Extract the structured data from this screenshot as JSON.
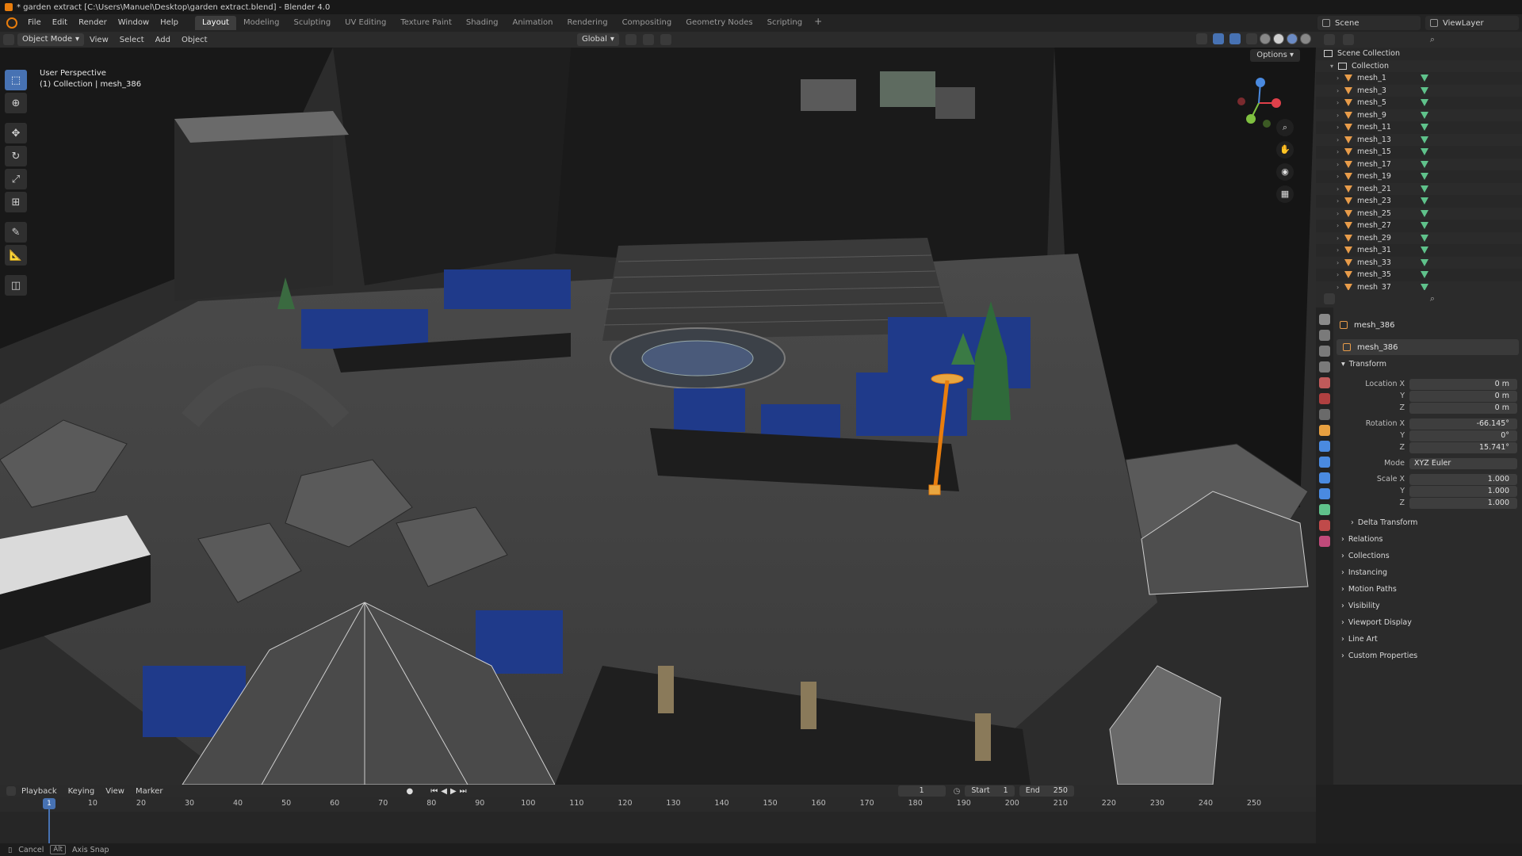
{
  "window": {
    "title": "* garden extract [C:\\Users\\Manuel\\Desktop\\garden extract.blend] - Blender 4.0"
  },
  "menu": [
    "File",
    "Edit",
    "Render",
    "Window",
    "Help"
  ],
  "workspaces": [
    "Layout",
    "Modeling",
    "Sculpting",
    "UV Editing",
    "Texture Paint",
    "Shading",
    "Animation",
    "Rendering",
    "Compositing",
    "Geometry Nodes",
    "Scripting"
  ],
  "workspace_add": "+",
  "scene": {
    "label": "Scene",
    "view_layer": "ViewLayer"
  },
  "viewport_header": {
    "mode": "Object Mode",
    "menus": [
      "View",
      "Select",
      "Add",
      "Object"
    ],
    "orientation": "Global",
    "options": "Options"
  },
  "viewport": {
    "perspective": "User Perspective",
    "context": "(1) Collection | mesh_386"
  },
  "outliner": {
    "scene_collection": "Scene Collection",
    "collection": "Collection",
    "items": [
      "mesh_1",
      "mesh_3",
      "mesh_5",
      "mesh_9",
      "mesh_11",
      "mesh_13",
      "mesh_15",
      "mesh_17",
      "mesh_19",
      "mesh_21",
      "mesh_23",
      "mesh_25",
      "mesh_27",
      "mesh_29",
      "mesh_31",
      "mesh_33",
      "mesh_35",
      "mesh_37"
    ]
  },
  "properties": {
    "object_name": "mesh_386",
    "data_name": "mesh_386",
    "transform_label": "Transform",
    "location_label": "Location X",
    "location": [
      "0 m",
      "0 m",
      "0 m"
    ],
    "rotation_label": "Rotation X",
    "rotation": [
      "-66.145°",
      "0°",
      "15.741°"
    ],
    "mode_label": "Mode",
    "mode": "XYZ Euler",
    "scale_label": "Scale X",
    "scale": [
      "1.000",
      "1.000",
      "1.000"
    ],
    "axis_y": "Y",
    "axis_z": "Z",
    "delta_transform": "Delta Transform",
    "sections": [
      "Relations",
      "Collections",
      "Instancing",
      "Motion Paths",
      "Visibility",
      "Viewport Display",
      "Line Art",
      "Custom Properties"
    ]
  },
  "timeline": {
    "menus": [
      "Playback",
      "Keying",
      "View",
      "Marker"
    ],
    "current_frame": "1",
    "start_label": "Start",
    "start": "1",
    "end_label": "End",
    "end": "250",
    "ticks": [
      "1",
      "10",
      "20",
      "30",
      "40",
      "50",
      "60",
      "70",
      "80",
      "90",
      "100",
      "110",
      "120",
      "130",
      "140",
      "150",
      "160",
      "170",
      "180",
      "190",
      "200",
      "210",
      "220",
      "230",
      "240",
      "250"
    ]
  },
  "statusbar": {
    "cancel": "Cancel",
    "alt_key": "Alt",
    "axis_snap": "Axis Snap"
  },
  "colors": {
    "accent": "#4772b3",
    "selection": "#e87d0d",
    "mesh_icon": "#e89c4a",
    "data_icon": "#5fc28b"
  }
}
